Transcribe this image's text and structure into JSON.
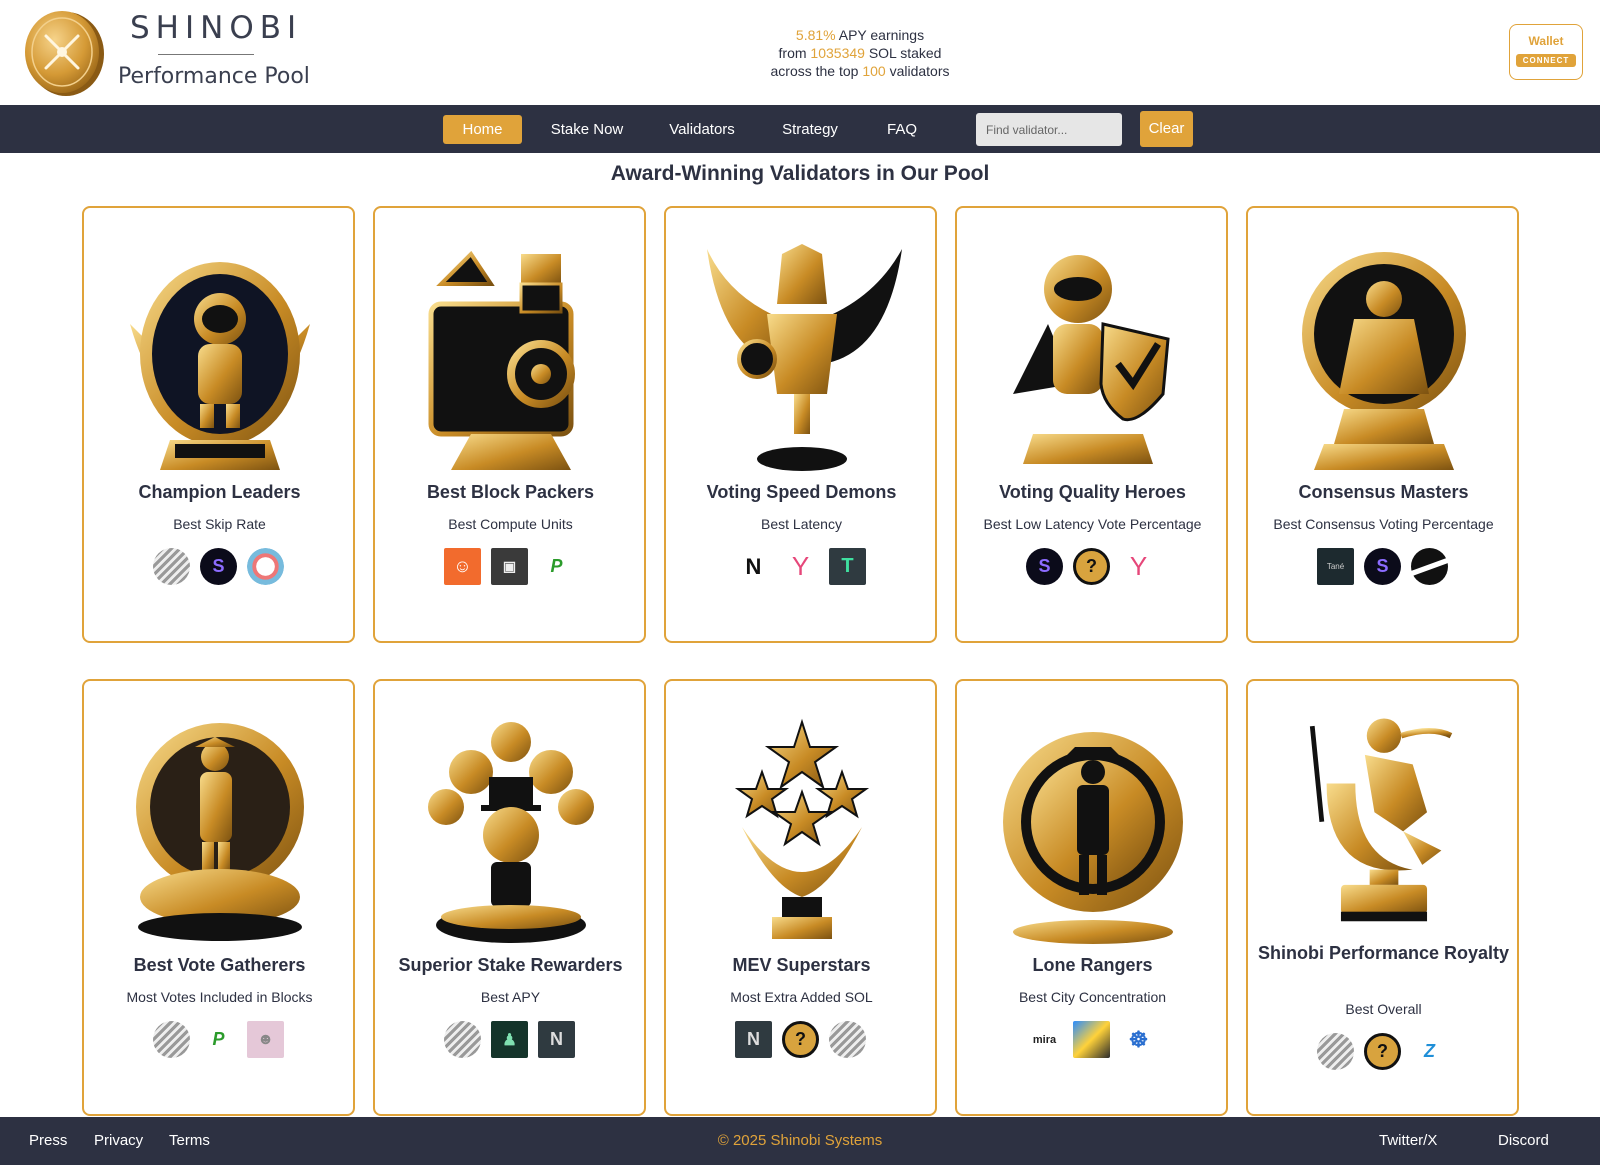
{
  "brand": {
    "name": "SHINOBI",
    "tagline": "Performance Pool"
  },
  "stats": {
    "apy": "5.81%",
    "apy_text": "APY earnings",
    "from_text": "from",
    "sol_staked": "1035349",
    "staked_text": "SOL staked",
    "across_text": "across the top",
    "validator_count": "100",
    "validators_text": "validators"
  },
  "wallet": {
    "label": "Wallet",
    "connect": "CONNECT"
  },
  "nav": {
    "home": "Home",
    "stake": "Stake Now",
    "validators": "Validators",
    "strategy": "Strategy",
    "faq": "FAQ"
  },
  "search": {
    "placeholder": "Find validator...",
    "clear": "Clear"
  },
  "page_title": "Award-Winning Validators in Our Pool",
  "cards": [
    {
      "title": "Champion Leaders",
      "subtitle": "Best Skip Rate",
      "trophy": "astronaut-trophy-icon"
    },
    {
      "title": "Best Block Packers",
      "subtitle": "Best Compute Units",
      "trophy": "block-packer-trophy-icon"
    },
    {
      "title": "Voting Speed Demons",
      "subtitle": "Best Latency",
      "trophy": "winged-hero-trophy-icon"
    },
    {
      "title": "Voting Quality Heroes",
      "subtitle": "Best Low Latency Vote Percentage",
      "trophy": "shield-hero-trophy-icon"
    },
    {
      "title": "Consensus Masters",
      "subtitle": "Best Consensus Voting Percentage",
      "trophy": "sage-trophy-icon"
    },
    {
      "title": "Best Vote Gatherers",
      "subtitle": "Most Votes Included in Blocks",
      "trophy": "explorer-trophy-icon"
    },
    {
      "title": "Superior Stake Rewarders",
      "subtitle": "Best APY",
      "trophy": "tycoon-trophy-icon"
    },
    {
      "title": "MEV Superstars",
      "subtitle": "Most Extra Added SOL",
      "trophy": "stars-trophy-icon"
    },
    {
      "title": "Lone Rangers",
      "subtitle": "Best City Concentration",
      "trophy": "cowboy-trophy-icon"
    },
    {
      "title": "Shinobi Performance Royalty",
      "subtitle": "Best Overall",
      "trophy": "ninja-trophy-icon"
    }
  ],
  "logo_text": {
    "t": "T",
    "y": "Y",
    "n": "N",
    "q": "?",
    "mira": "mira",
    "tane": "Tané"
  },
  "colors": {
    "accent": "#e0a33a",
    "navy": "#2d3142",
    "white": "#ffffff"
  },
  "footer": {
    "press": "Press",
    "privacy": "Privacy",
    "terms": "Terms",
    "copyright": "© 2025 Shinobi Systems",
    "twitter": "Twitter/X",
    "discord": "Discord"
  }
}
